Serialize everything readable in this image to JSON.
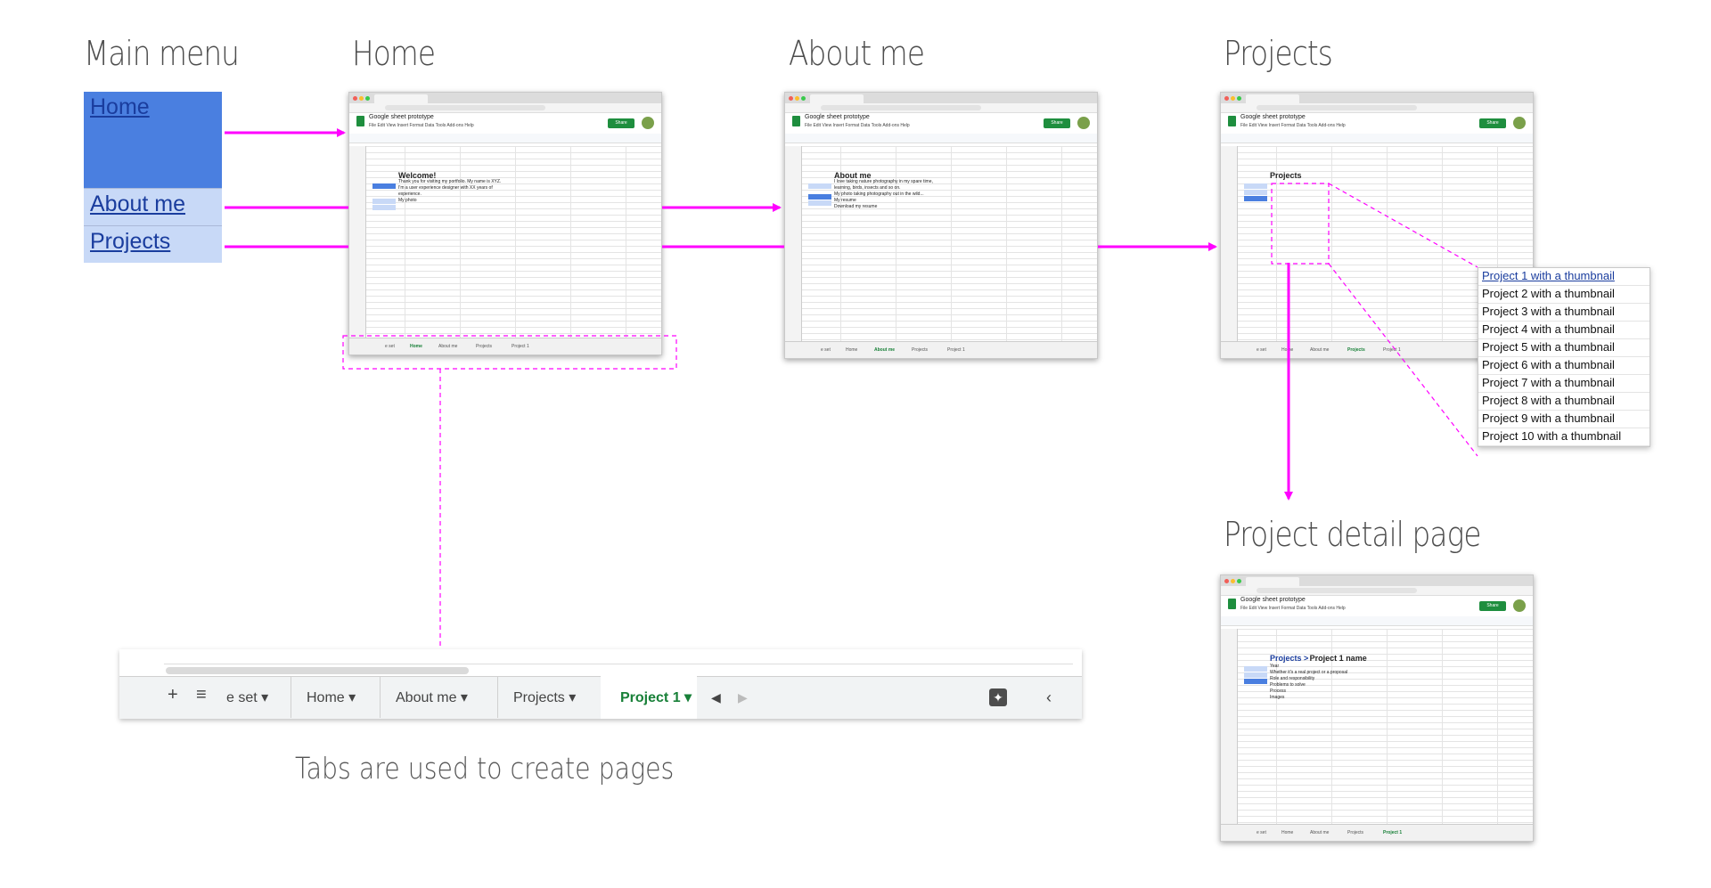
{
  "titles": {
    "main_menu": "Main menu",
    "home": "Home",
    "about": "About me",
    "projects": "Projects",
    "detail": "Project detail page"
  },
  "caption": "Tabs are used to create pages",
  "menu": {
    "home": "Home",
    "about": "About me",
    "projects": "Projects"
  },
  "sheet": {
    "doc_name": "Google sheet prototype",
    "menubar": "File  Edit  View  Insert  Format  Data  Tools  Add-ons  Help",
    "share": "Share"
  },
  "home_shot": {
    "heading": "Welcome!",
    "lines": [
      "Thank you for visiting my portfolio. My name is XYZ.",
      "I'm a user experience designer with XX years of",
      "experience.",
      "My photo"
    ]
  },
  "about_shot": {
    "heading": "About me",
    "lines": [
      "I love taking nature photography in my spare time,",
      "learning, birds, insects and so on.",
      "My photo taking photography out in the wild...",
      "My resume",
      "Download my resume"
    ]
  },
  "projects_shot": {
    "heading": "Projects"
  },
  "detail_shot": {
    "breadcrumb": "Projects >",
    "heading": "Project 1 name",
    "lines": [
      "Year",
      "Whether it's a real project or a proposal",
      "Role and responsibility",
      "Problems to solve",
      "Process",
      "Images"
    ]
  },
  "project_list": [
    "Project 1 with a thumbnail",
    "Project 2 with a thumbnail",
    "Project 3 with a thumbnail",
    "Project 4 with a thumbnail",
    "Project 5 with a thumbnail",
    "Project 6 with a thumbnail",
    "Project 7 with a thumbnail",
    "Project 8 with a thumbnail",
    "Project 9 with a thumbnail",
    "Project 10 with a thumbnail"
  ],
  "tabs": {
    "partial": "e set",
    "home": "Home",
    "about": "About me",
    "projects": "Projects",
    "project1": "Project 1"
  },
  "colors": {
    "arrow": "#ff00ff",
    "menu_active": "#4a7fe0",
    "menu_inactive": "#c8d9f7",
    "active_tab": "#188038"
  }
}
